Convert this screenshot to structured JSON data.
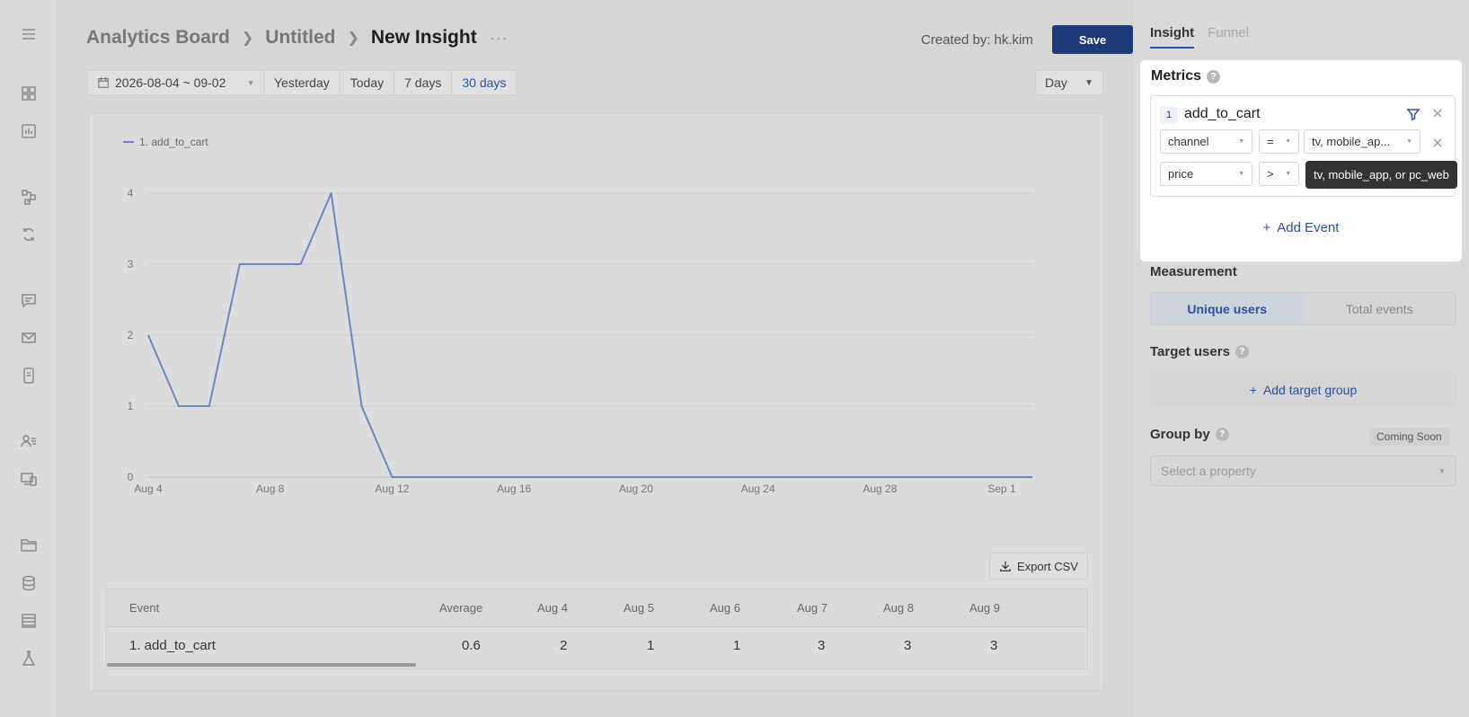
{
  "breadcrumb": {
    "items": [
      "Analytics Board",
      "Untitled",
      "New Insight"
    ],
    "more": "···"
  },
  "header": {
    "created_label": "Created by:",
    "created_by": "hk.kim",
    "save_label": "Save"
  },
  "date_filter": {
    "range": "2026-08-04 ~ 09-02",
    "presets": [
      "Yesterday",
      "Today",
      "7 days",
      "30 days"
    ],
    "active_preset": "30 days",
    "granularity": "Day"
  },
  "chart_data": {
    "type": "line",
    "x": [
      "Aug 4",
      "Aug 5",
      "Aug 6",
      "Aug 7",
      "Aug 8",
      "Aug 9",
      "Aug 10",
      "Aug 11",
      "Aug 12",
      "Aug 13",
      "Aug 14",
      "Aug 15",
      "Aug 16",
      "Aug 17",
      "Aug 18",
      "Aug 19",
      "Aug 20",
      "Aug 21",
      "Aug 22",
      "Aug 23",
      "Aug 24",
      "Aug 25",
      "Aug 26",
      "Aug 27",
      "Aug 28",
      "Aug 29",
      "Aug 30",
      "Aug 31",
      "Sep 1",
      "Sep 2"
    ],
    "x_ticks": [
      "Aug 4",
      "Aug 8",
      "Aug 12",
      "Aug 16",
      "Aug 20",
      "Aug 24",
      "Aug 28",
      "Sep 1"
    ],
    "series": [
      {
        "name": "1. add_to_cart",
        "values": [
          2,
          1,
          1,
          3,
          3,
          3,
          4,
          1,
          0,
          0,
          0,
          0,
          0,
          0,
          0,
          0,
          0,
          0,
          0,
          0,
          0,
          0,
          0,
          0,
          0,
          0,
          0,
          0,
          0,
          0
        ]
      }
    ],
    "ylim": [
      0,
      4
    ],
    "y_ticks": [
      0,
      1,
      2,
      3,
      4
    ],
    "grid": true,
    "legend": "top-left",
    "color": "#6b87b8"
  },
  "export_label": "Export CSV",
  "table": {
    "headers": [
      "Event",
      "Average",
      "Aug 4",
      "Aug 5",
      "Aug 6",
      "Aug 7",
      "Aug 8",
      "Aug 9"
    ],
    "rows": [
      [
        "1. add_to_cart",
        "0.6",
        "2",
        "1",
        "1",
        "3",
        "3",
        "3"
      ]
    ]
  },
  "panel": {
    "tabs": [
      "Insight",
      "Funnel"
    ],
    "active_tab": "Insight",
    "metrics_title": "Metrics",
    "event": {
      "index": "1",
      "name": "add_to_cart",
      "filters": [
        {
          "property": "channel",
          "operator": "=",
          "value": "tv, mobile_ap..."
        },
        {
          "property": "price",
          "operator": ">",
          "value": ""
        }
      ]
    },
    "tooltip": "tv, mobile_app, or pc_web",
    "add_event_label": "Add Event",
    "measurement_title": "Measurement",
    "measurement_options": [
      "Unique users",
      "Total events"
    ],
    "target_users_title": "Target users",
    "add_target_label": "Add target group",
    "group_by_title": "Group by",
    "coming_soon": "Coming Soon",
    "property_placeholder": "Select a property"
  }
}
